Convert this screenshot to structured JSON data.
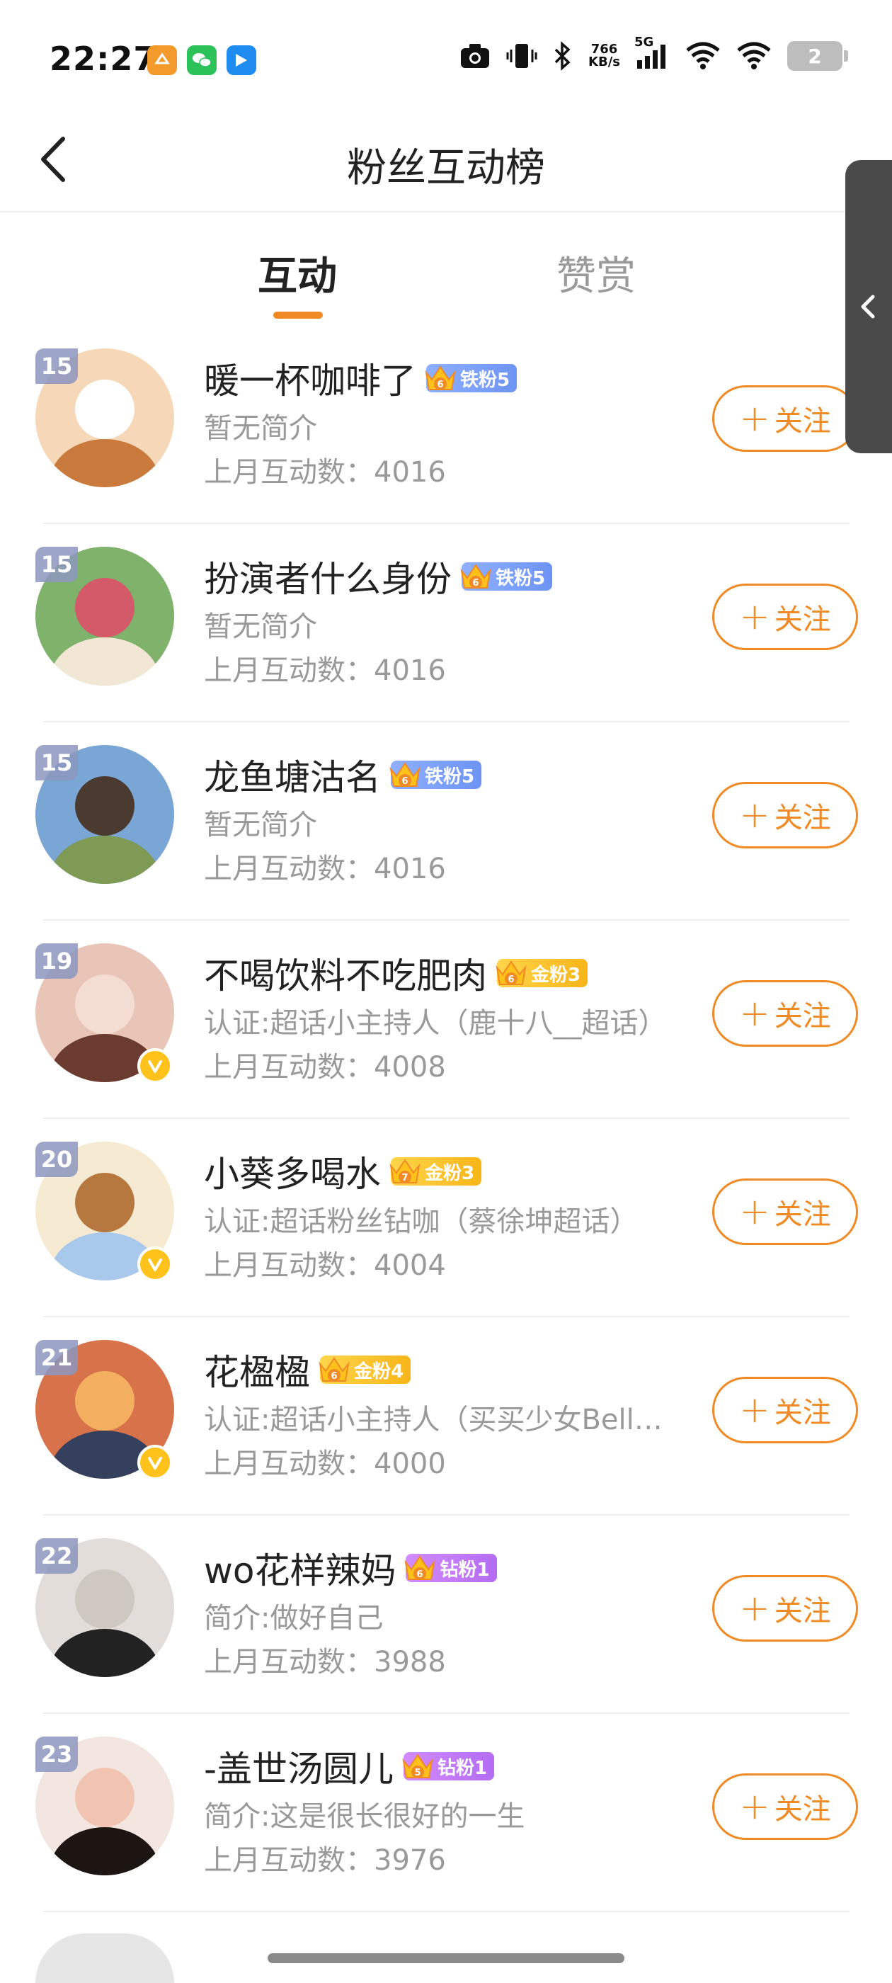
{
  "status_bar": {
    "time": "22:27",
    "net_speed_value": "766",
    "net_speed_unit": "KB/s",
    "network": "5G",
    "battery": "2"
  },
  "nav": {
    "title": "粉丝互动榜"
  },
  "tabs": [
    {
      "label": "互动",
      "active": true
    },
    {
      "label": "赞赏",
      "active": false
    }
  ],
  "follow_label": "关注",
  "users": [
    {
      "rank": "15",
      "name": "暖一杯咖啡了",
      "badge": "铁粉5",
      "badge_type": "iron",
      "crown_level": "6",
      "bio": "暂无简介",
      "count": "上月互动数：4016",
      "verified": false,
      "avatar_colors": [
        "#f6d8b8",
        "#c97a3c",
        "#ffffff"
      ]
    },
    {
      "rank": "15",
      "name": "扮演者什么身份",
      "badge": "铁粉5",
      "badge_type": "iron",
      "crown_level": "6",
      "bio": "暂无简介",
      "count": "上月互动数：4016",
      "verified": false,
      "avatar_colors": [
        "#7fb26a",
        "#f2e7d4",
        "#d45a6a"
      ]
    },
    {
      "rank": "15",
      "name": "龙鱼塘沽名",
      "badge": "铁粉5",
      "badge_type": "iron",
      "crown_level": "6",
      "bio": "暂无简介",
      "count": "上月互动数：4016",
      "verified": false,
      "avatar_colors": [
        "#7aa6d6",
        "#7e9a55",
        "#4a3a30"
      ]
    },
    {
      "rank": "19",
      "name": "不喝饮料不吃肥肉",
      "badge": "金粉3",
      "badge_type": "gold",
      "crown_level": "6",
      "bio": "认证:超话小主持人（鹿十八__超话）",
      "count": "上月互动数：4008",
      "verified": true,
      "avatar_colors": [
        "#e9c5b8",
        "#6a3b2e",
        "#f4ddd2"
      ]
    },
    {
      "rank": "20",
      "name": "小葵多喝水",
      "badge": "金粉3",
      "badge_type": "gold",
      "crown_level": "7",
      "bio": "认证:超话粉丝钻咖（蔡徐坤超话）",
      "count": "上月互动数：4004",
      "verified": true,
      "avatar_colors": [
        "#f7ead2",
        "#a8c9ec",
        "#b6783e"
      ]
    },
    {
      "rank": "21",
      "name": "花楹楹",
      "badge": "金粉4",
      "badge_type": "gold",
      "crown_level": "6",
      "bio": "认证:超话小主持人（买买少女Bell超话）",
      "count": "上月互动数：4000",
      "verified": true,
      "avatar_colors": [
        "#d8724a",
        "#35405e",
        "#f4b060"
      ]
    },
    {
      "rank": "22",
      "name": "wo花样辣妈",
      "badge": "钻粉1",
      "badge_type": "diamond",
      "crown_level": "6",
      "bio": "简介:做好自己",
      "count": "上月互动数：3988",
      "verified": false,
      "avatar_colors": [
        "#e2ddd8",
        "#222222",
        "#cfc9c2"
      ]
    },
    {
      "rank": "23",
      "name": "-盖世汤圆儿",
      "badge": "钻粉1",
      "badge_type": "diamond",
      "crown_level": "5",
      "bio": "简介:这是很长很好的一生",
      "count": "上月互动数：3976",
      "verified": false,
      "avatar_colors": [
        "#f3e6e0",
        "#1d1512",
        "#f2c4b2"
      ]
    }
  ]
}
